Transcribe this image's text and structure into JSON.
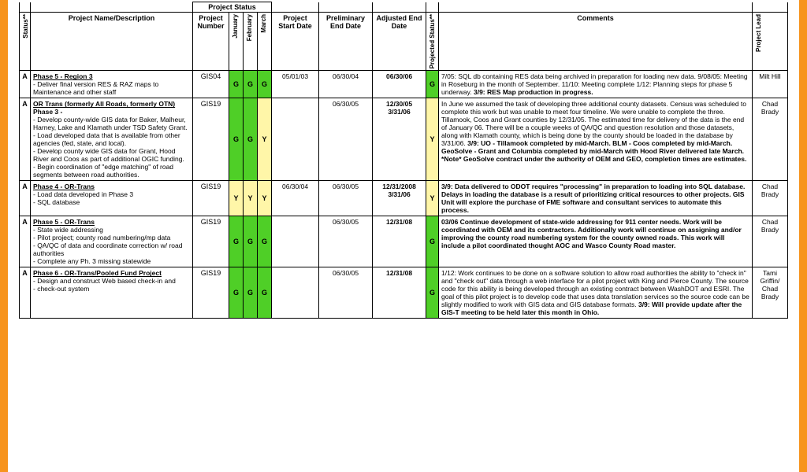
{
  "headers": {
    "banner": "Project Status",
    "status": "Status**",
    "desc": "Project Name/Description",
    "number": "Project Number",
    "m1": "January",
    "m2": "February",
    "m3": "March",
    "start": "Project Start Date",
    "prelim": "Preliminary End Date",
    "adj": "Adjusted End Date",
    "pstat": "Projected Status**",
    "comments": "Comments",
    "lead": "Project Lead"
  },
  "rows": [
    {
      "status": "A",
      "phase": "Phase 5 - Region 3",
      "desc_lines": [
        "  - Deliver final version RES & RAZ maps to Maintenance and other staff"
      ],
      "number": "GIS04",
      "m": [
        "G",
        "G",
        "G"
      ],
      "start": "05/01/03",
      "prelim": "06/30/04",
      "adj": "06/30/06",
      "pstat": "G",
      "comments": "7/05: SQL db containing RES data being archived in preparation for loading new data.  9/08/05:  Meeting in Roseburg in the month of September.  11/10: Meeting complete 1/12: Planning steps for phase 5 underway.  ",
      "comments_bold": "3/9: RES Map production in progress.",
      "lead": "Milt Hill"
    },
    {
      "status": "A",
      "phase": "OR Trans (formerly All Roads, formerly OTN)",
      "phase2": "Phase 3 -",
      "desc_lines": [
        "- Develop county-wide GIS data for Baker, Malheur, Harney, Lake and Klamath under TSD Safety Grant.",
        "-   Load developed data that is available from other agencies (fed, state, and local).",
        "-   Develop county wide GIS data for Grant, Hood River and Coos as part of additional OGIC funding.",
        "-   Begin coordination of \"edge matching\" of road segments between road authorities."
      ],
      "number": "GIS19",
      "m": [
        "G",
        "G",
        "Y"
      ],
      "start": "",
      "prelim": "06/30/05",
      "adj": "12/30/05 3/31/06",
      "pstat": "Y",
      "comments": "In June we assumed the task of developing three additional  county datasets. Census was scheduled to complete this work but was unable to meet four timeline. We were unable to complete the three. Tillamook, Coos and Grant counties by 12/31/05. The estimated time for delivery of the data is the end of January 06. There will be a couple weeks of QA/QC and question resolution and those datasets, along with Klamath county, which is being done by the county should be loaded in the database by 3/31/06.  ",
      "comments_bold": "3/9: UO - Tillamook completed by mid-March. BLM - Coos completed by mid-March. GeoSolve - Grant and Columbia completed by mid-March with Hood River delivered late March. *Note* GeoSolve contract under the authority of OEM and GEO, completion times are estimates.",
      "lead": "Chad Brady"
    },
    {
      "status": "A",
      "phase": "Phase 4 - OR-Trans",
      "desc_lines": [
        " - Load data developed in Phase 3",
        " - SQL database"
      ],
      "number": "GIS19",
      "m": [
        "Y",
        "Y",
        "Y"
      ],
      "start": "06/30/04",
      "prelim": "06/30/05",
      "adj": "12/31/2008 3/31/06",
      "pstat": "Y",
      "comments": "",
      "comments_bold": "3/9: Data delivered to ODOT requires \"processing\" in preparation to loading into SQL database. Delays in loading the database is a result of prioritizing critical resources to other projects. GIS Unit will explore the purchase of FME software and consultant services to automate this process.",
      "lead": "Chad Brady"
    },
    {
      "status": "A",
      "phase": "Phase 5 - OR-Trans",
      "desc_lines": [
        "  - State wide addressing",
        "   - Pilot project; county road numbering/mp data",
        "   - QA/QC of data and coordinate correction w/ road authorities",
        "   - Complete any Ph. 3 missing statewide"
      ],
      "number": "GIS19",
      "m": [
        "G",
        "G",
        "G"
      ],
      "start": "",
      "prelim": "06/30/05",
      "adj": "12/31/08",
      "pstat": "G",
      "comments": "",
      "comments_bold": "03/06 Continue development of state-wide addressing for 911 center needs.  Work will be coordinated with OEM and its contractors.  Additionally work will continue on assigning and/or improving the county road numbering system for the county owned roads.  This work will include a pilot coordinated thought AOC and Wasco County Road master.",
      "lead": "Chad Brady"
    },
    {
      "status": "A",
      "phase": "Phase 6 - OR-Trans/Pooled Fund Project",
      "desc_lines": [
        "   - Design and construct Web based check-in and",
        "   - check-out system"
      ],
      "number": "GIS19",
      "m": [
        "G",
        "G",
        "G"
      ],
      "start": "",
      "prelim": "06/30/05",
      "adj": "12/31/08",
      "pstat": "G",
      "comments": "1/12: Work continues to be done on a software solution to allow road authorities the ability to \"check in\" and \"check out\" data through a web interface for a pilot project with King and Pierce County. The source code for this ability is being developed through an existing contract between WashDOT and ESRI. The goal of this pilot project is to develop code that uses data translation services so the source code can be slightly modified to work with GIS data and GIS database formats.  ",
      "comments_bold": "3/9: Will provide update after the GIS-T meeting to be held later this month in Ohio.",
      "lead": "Tami Griffin/ Chad Brady"
    }
  ]
}
